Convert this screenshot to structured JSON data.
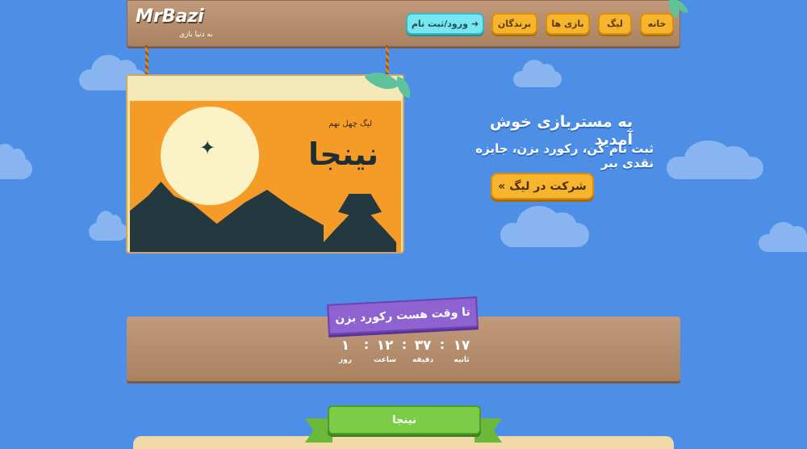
{
  "header": {
    "logo": "MrBazi",
    "tagline": "به دنیا بازی",
    "nav": {
      "home": "خانه",
      "league": "لیگ",
      "games": "بازی ها",
      "winners": "برندگان",
      "login": "ورود/ثبت نام"
    }
  },
  "poster": {
    "subtitle": "لیگ چهل نهم",
    "title": "نینجا"
  },
  "welcome": {
    "title": "به مستربازی خوش آمدید",
    "subtitle": "ثبت نام کن، رکورد بزن، جایزه نقدی ببر",
    "join_label": "شرکت در لیگ »"
  },
  "countdown": {
    "title": "تا وقت هست رکورد بزن",
    "seconds": {
      "value": "۱۷",
      "label": "ثانیه"
    },
    "minutes": {
      "value": "۳۷",
      "label": "دقیقه"
    },
    "hours": {
      "value": "۱۲",
      "label": "ساعت"
    },
    "days": {
      "value": "۱",
      "label": "روز"
    },
    "separator": ":"
  },
  "game_section": {
    "title": "نینجا"
  },
  "colors": {
    "background": "#4d8fe6",
    "button": "#f7b52d",
    "login_button": "#76e6f0",
    "ribbon": "#8e63d1",
    "wood": "#b08868"
  }
}
